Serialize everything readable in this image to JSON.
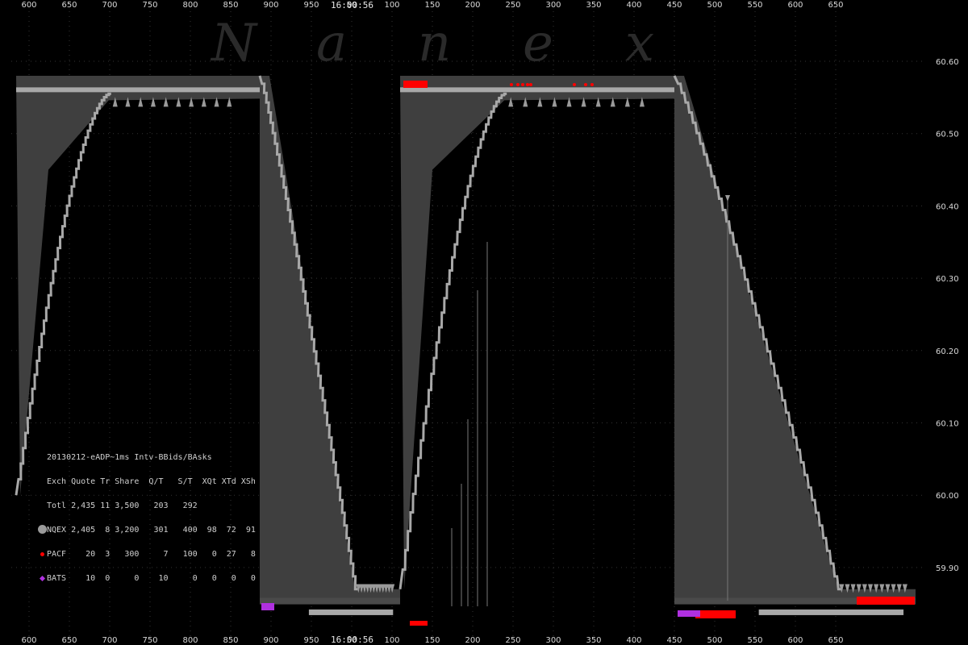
{
  "watermark": "Nanex",
  "time_label": "16:00:56",
  "chart_data": {
    "type": "scatter",
    "x_ticks": [
      "600",
      "650",
      "700",
      "750",
      "800",
      "850",
      "900",
      "950",
      "50",
      "100",
      "150",
      "200",
      "250",
      "300",
      "350",
      "400",
      "450",
      "500",
      "550",
      "600",
      "650"
    ],
    "y_ticks": [
      "60.60",
      "60.50",
      "60.40",
      "60.30",
      "60.20",
      "60.10",
      "60.00",
      "59.90"
    ],
    "ylim": [
      59.83,
      60.62
    ],
    "grid": true,
    "segments": [
      {
        "x_start": 20,
        "x_end": 322,
        "pattern": "rise-then-flat",
        "low": 60.0,
        "high": 60.58
      },
      {
        "x_start": 322,
        "x_end": 496,
        "pattern": "fall-then-flat",
        "low": 59.85,
        "high": 60.58
      },
      {
        "x_start": 496,
        "x_end": 836,
        "pattern": "rise-then-flat",
        "low": 59.87,
        "high": 60.58
      },
      {
        "x_start": 836,
        "x_end": 1135,
        "pattern": "fall-then-flat",
        "low": 59.85,
        "high": 60.58
      }
    ],
    "series": [
      {
        "name": "NQEX",
        "color": "#9a9a9a"
      },
      {
        "name": "PACF",
        "color": "#ff0000"
      },
      {
        "name": "BATS",
        "color": "#b030e0"
      }
    ]
  },
  "legend": {
    "title": "20130212-eADP~1ms Intv-BBids/BAsks",
    "header": "Exch Quote Tr Share  Q/T   S/T  XQt XTd XSh",
    "rows": [
      {
        "label": "Totl 2,435 11 3,500   203   292",
        "color": ""
      },
      {
        "label": "NQEX 2,405  8 3,200   301   400  98  72  91",
        "color": "#9a9a9a"
      },
      {
        "label": "PACF    20  3   300     7   100   0  27   8",
        "color": "#ff0000"
      },
      {
        "label": "BATS    10  0     0    10     0   0   0   0",
        "color": "#b030e0"
      }
    ]
  }
}
